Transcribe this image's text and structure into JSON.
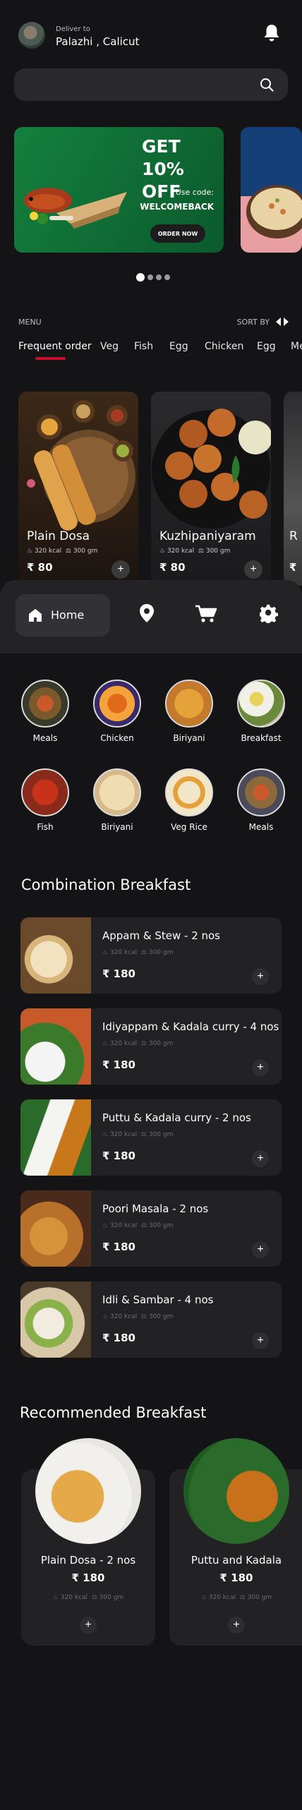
{
  "header": {
    "deliver_label": "Deliver to",
    "location": "Palazhi , Calicut"
  },
  "search": {
    "placeholder": ""
  },
  "promo": {
    "title_line1": "GET",
    "title_line2": "10% OFF",
    "code_label": "Use code:",
    "code": "WELCOMEBACK",
    "button": "ORDER NOW"
  },
  "menu": {
    "label": "MENU",
    "sort_label": "SORT BY",
    "tabs": [
      "Frequent order",
      "Veg",
      "Fish",
      "Egg",
      "Chicken",
      "Egg",
      "Me"
    ]
  },
  "featured": [
    {
      "name": "Plain Dosa",
      "kcal": "320 kcal",
      "weight": "300 gm",
      "price": "₹ 80"
    },
    {
      "name": "Kuzhipaniyaram",
      "kcal": "320 kcal",
      "weight": "300 gm",
      "price": "₹ 80"
    },
    {
      "name": "R",
      "price": "₹"
    }
  ],
  "nav": {
    "home": "Home"
  },
  "categories": [
    "Meals",
    "Chicken",
    "Biriyani",
    "Breakfast",
    "Fish",
    "Biriyani",
    "Veg Rice",
    "Meals"
  ],
  "combination": {
    "title": "Combination Breakfast",
    "items": [
      {
        "name": "Appam & Stew - 2 nos",
        "kcal": "320 kcal",
        "weight": "300 gm",
        "price": "₹ 180"
      },
      {
        "name": "Idiyappam & Kadala curry - 4 nos",
        "kcal": "320 kcal",
        "weight": "300 gm",
        "price": "₹ 180"
      },
      {
        "name": "Puttu & Kadala curry - 2 nos",
        "kcal": "320 kcal",
        "weight": "300 gm",
        "price": "₹ 180"
      },
      {
        "name": "Poori Masala - 2 nos",
        "kcal": "320 kcal",
        "weight": "300 gm",
        "price": "₹ 180"
      },
      {
        "name": "Idli & Sambar - 4 nos",
        "kcal": "320 kcal",
        "weight": "300 gm",
        "price": "₹ 180"
      }
    ]
  },
  "recommended": {
    "title": "Recommended Breakfast",
    "items": [
      {
        "name": "Plain Dosa - 2 nos",
        "price": "₹ 180",
        "kcal": "320 kcal",
        "weight": "300 gm"
      },
      {
        "name": "Puttu and Kadala",
        "price": "₹ 180",
        "kcal": "320 kcal",
        "weight": "300 gm"
      }
    ]
  },
  "colors": {
    "background": "#141416",
    "card": "#222225",
    "accent_red": "#c8102e",
    "promo_green": "#14803e"
  }
}
